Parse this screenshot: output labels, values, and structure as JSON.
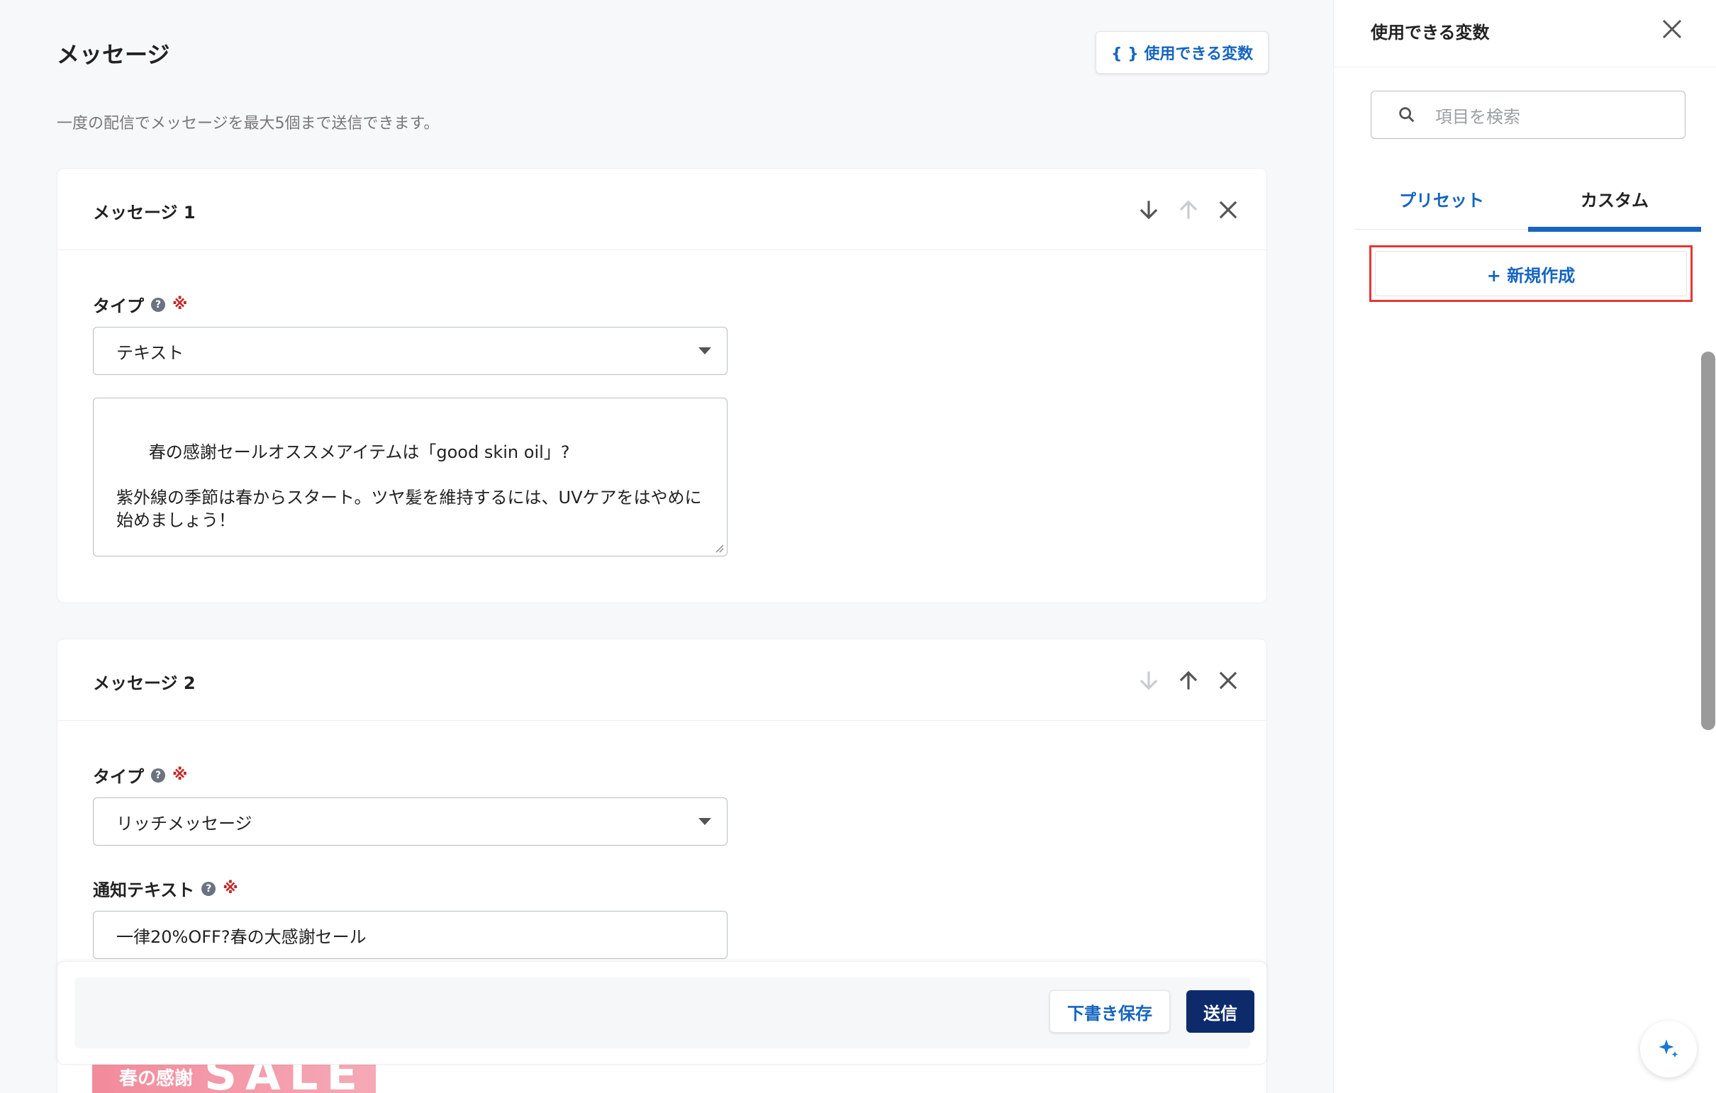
{
  "header": {
    "title": "メッセージ",
    "vars_button": "{ } 使用できる変数",
    "description": "一度の配信でメッセージを最大5個まで送信できます。"
  },
  "messages": [
    {
      "title": "メッセージ 1",
      "type_label": "タイプ",
      "required_mark": "※",
      "type_value": "テキスト",
      "body": "春の感謝セールオススメアイテムは「good skin oil」?\n\n紫外線の季節は春からスタート。ツヤ髪を維持するには、UVケアをはやめに始めましょう！\n\n》good skin oilの購入はこちらから"
    },
    {
      "title": "メッセージ 2",
      "type_label": "タイプ",
      "required_mark": "※",
      "type_value": "リッチメッセージ",
      "notify_label": "通知テキスト",
      "notify_value": "一律20%OFF?春の大感謝セール"
    }
  ],
  "banner": {
    "jp": "春の感謝",
    "sale": "SALE"
  },
  "footer": {
    "draft": "下書き保存",
    "send": "送信"
  },
  "panel": {
    "title": "使用できる変数",
    "search_placeholder": "項目を検索",
    "tabs": [
      "プリセット",
      "カスタム"
    ],
    "active_tab": "カスタム",
    "new_button": "+ 新規作成"
  },
  "colors": {
    "accent": "#1565c0",
    "primary_button": "#0d2a6b",
    "required": "#c62828",
    "highlight": "#e53935"
  }
}
